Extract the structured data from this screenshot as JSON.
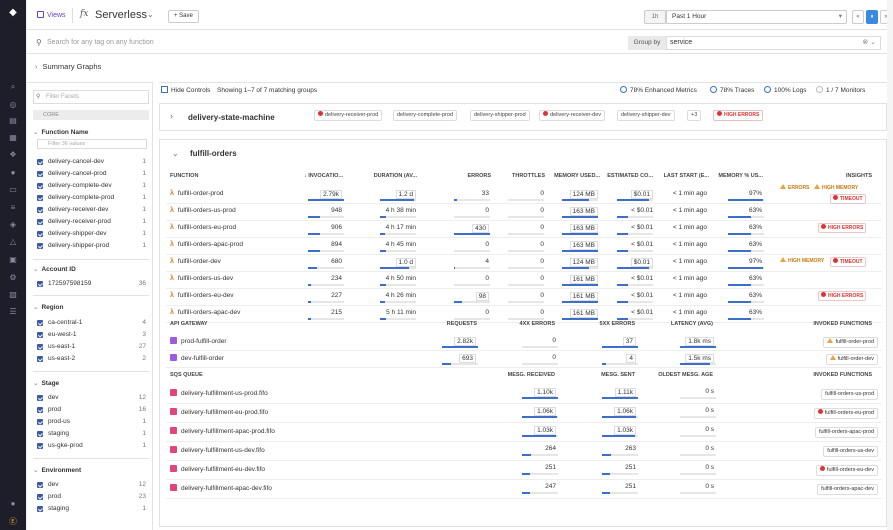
{
  "nav_icons": [
    "dog-logo-icon",
    "search-icon",
    "binoculars-icon",
    "dashboard-icon",
    "grid-icon",
    "infrastructure-icon",
    "apm-icon",
    "notebook-icon",
    "logs-icon",
    "security-icon",
    "synthetics-icon",
    "rum-icon",
    "ci-icon",
    "integrations-icon",
    "plug-icon",
    "chat-icon",
    "help-icon"
  ],
  "topbar": {
    "views_label": "Views",
    "fx": "fx",
    "title": "Serverless",
    "save_label": "+ Save",
    "time_preset": "1h",
    "time_range": "Past 1 Hour",
    "controls": [
      "«",
      "⏸",
      "»",
      "⌕"
    ]
  },
  "search": {
    "placeholder": "Search for any tag on any function",
    "group_by_label": "Group by",
    "group_by_value": "service"
  },
  "summary_graphs": "Summary Graphs",
  "sidebar": {
    "filter_placeholder": "Filter Facets",
    "core_label": "CORE",
    "function_name": {
      "title": "Function Name",
      "filter_placeholder": "Filter 36 values",
      "items": [
        {
          "name": "delivery-cancel-dev",
          "count": "1"
        },
        {
          "name": "delivery-cancel-prod",
          "count": "1"
        },
        {
          "name": "delivery-complete-dev",
          "count": "1"
        },
        {
          "name": "delivery-complete-prod",
          "count": "1"
        },
        {
          "name": "delivery-receiver-dev",
          "count": "1"
        },
        {
          "name": "delivery-receiver-prod",
          "count": "1"
        },
        {
          "name": "delivery-shipper-dev",
          "count": "1"
        },
        {
          "name": "delivery-shipper-prod",
          "count": "1"
        }
      ]
    },
    "account_id": {
      "title": "Account ID",
      "items": [
        {
          "name": "172597598159",
          "count": "36"
        }
      ]
    },
    "region": {
      "title": "Region",
      "items": [
        {
          "name": "ca-central-1",
          "count": "4"
        },
        {
          "name": "eu-west-1",
          "count": "3"
        },
        {
          "name": "us-east-1",
          "count": "27"
        },
        {
          "name": "us-east-2",
          "count": "2"
        }
      ]
    },
    "stage": {
      "title": "Stage",
      "items": [
        {
          "name": "dev",
          "count": "12"
        },
        {
          "name": "prod",
          "count": "16"
        },
        {
          "name": "prod-us",
          "count": "1"
        },
        {
          "name": "staging",
          "count": "1"
        },
        {
          "name": "us-gke-prod",
          "count": "1"
        }
      ]
    },
    "environment": {
      "title": "Environment",
      "items": [
        {
          "name": "dev",
          "count": "12"
        },
        {
          "name": "prod",
          "count": "23"
        },
        {
          "name": "staging",
          "count": "1"
        }
      ]
    }
  },
  "main": {
    "hide_controls": "Hide Controls",
    "showing": "Showing 1–7 of 7 matching groups",
    "enhanced": "78% Enhanced Metrics",
    "traces": "78% Traces",
    "logs": "100% Logs",
    "monitors": "1 / 7 Monitors",
    "dsm": {
      "name": "delivery-state-machine",
      "tags": [
        "delivery-receiver-prod",
        "delivery-complete-prod",
        "delivery-shipper-prod",
        "delivery-receiver-dev",
        "delivery-shipper-dev",
        "+3"
      ],
      "badge": "HIGH ERRORS"
    },
    "group": {
      "name": "fulfill-orders",
      "headers": {
        "function": "FUNCTION",
        "invocations": "↓ INVOCATIO...",
        "duration": "DURATION (AV...",
        "errors": "ERRORS",
        "throttles": "THROTTLES",
        "memory": "MEMORY USED...",
        "cost": "ESTIMATED CO...",
        "last_start": "LAST START (E...",
        "mem_pct": "MEMORY % US...",
        "insights": "INSIGHTS"
      },
      "functions": [
        {
          "name": "fulfill-order-prod",
          "inv": "2.79k",
          "inv_f": 1.0,
          "dur": "1.2 d",
          "dur_f": 0.95,
          "err": "33",
          "err_f": 0.08,
          "thr": "0",
          "mem": "124 MB",
          "mem_f": 0.76,
          "cost": "$0.01",
          "cost_f": 0.9,
          "last": "< 1 min ago",
          "pct": "97%",
          "pct_f": 0.97,
          "ins": [
            {
              "t": "ERRORS",
              "k": "w"
            },
            {
              "t": "HIGH MEMORY",
              "k": "w"
            },
            {
              "t": "TIMEOUT",
              "k": "e"
            }
          ]
        },
        {
          "name": "fulfill-orders-us-prod",
          "inv": "948",
          "inv_f": 0.34,
          "dur": "4 h 38 min",
          "dur_f": 0.16,
          "err": "0",
          "err_f": 0,
          "thr": "0",
          "mem": "163 MB",
          "mem_f": 1.0,
          "cost": "< $0.01",
          "cost_f": 0.3,
          "last": "< 1 min ago",
          "pct": "63%",
          "pct_f": 0.63,
          "ins": []
        },
        {
          "name": "fulfill-orders-eu-prod",
          "inv": "906",
          "inv_f": 0.32,
          "dur": "4 h 17 min",
          "dur_f": 0.15,
          "err": "430",
          "err_f": 1.0,
          "thr": "0",
          "mem": "163 MB",
          "mem_f": 1.0,
          "cost": "< $0.01",
          "cost_f": 0.3,
          "last": "< 1 min ago",
          "pct": "63%",
          "pct_f": 0.63,
          "ins": [
            {
              "t": "HIGH ERRORS",
              "k": "e"
            }
          ]
        },
        {
          "name": "fulfill-orders-apac-prod",
          "inv": "894",
          "inv_f": 0.32,
          "dur": "4 h 45 min",
          "dur_f": 0.16,
          "err": "0",
          "err_f": 0,
          "thr": "0",
          "mem": "163 MB",
          "mem_f": 1.0,
          "cost": "< $0.01",
          "cost_f": 0.3,
          "last": "< 1 min ago",
          "pct": "63%",
          "pct_f": 0.63,
          "ins": []
        },
        {
          "name": "fulfill-order-dev",
          "inv": "680",
          "inv_f": 0.24,
          "dur": "1.0 d",
          "dur_f": 0.8,
          "err": "4",
          "err_f": 0.02,
          "thr": "0",
          "mem": "124 MB",
          "mem_f": 0.76,
          "cost": "$0.01",
          "cost_f": 0.9,
          "last": "< 1 min ago",
          "pct": "97%",
          "pct_f": 0.97,
          "ins": [
            {
              "t": "HIGH MEMORY",
              "k": "w"
            },
            {
              "t": "TIMEOUT",
              "k": "e"
            }
          ]
        },
        {
          "name": "fulfill-orders-us-dev",
          "inv": "234",
          "inv_f": 0.08,
          "dur": "4 h 50 min",
          "dur_f": 0.17,
          "err": "0",
          "err_f": 0,
          "thr": "0",
          "mem": "161 MB",
          "mem_f": 0.99,
          "cost": "< $0.01",
          "cost_f": 0.3,
          "last": "< 1 min ago",
          "pct": "63%",
          "pct_f": 0.63,
          "ins": []
        },
        {
          "name": "fulfill-orders-eu-dev",
          "inv": "227",
          "inv_f": 0.08,
          "dur": "4 h 26 min",
          "dur_f": 0.15,
          "err": "98",
          "err_f": 0.23,
          "thr": "0",
          "mem": "161 MB",
          "mem_f": 0.99,
          "cost": "< $0.01",
          "cost_f": 0.3,
          "last": "< 1 min ago",
          "pct": "63%",
          "pct_f": 0.63,
          "ins": [
            {
              "t": "HIGH ERRORS",
              "k": "e"
            }
          ]
        },
        {
          "name": "fulfill-orders-apac-dev",
          "inv": "215",
          "inv_f": 0.08,
          "dur": "5 h 11 min",
          "dur_f": 0.18,
          "err": "0",
          "err_f": 0,
          "thr": "0",
          "mem": "161 MB",
          "mem_f": 0.99,
          "cost": "< $0.01",
          "cost_f": 0.3,
          "last": "< 1 min ago",
          "pct": "63%",
          "pct_f": 0.63,
          "ins": []
        }
      ],
      "api_headers": {
        "name": "API GATEWAY",
        "requests": "REQUESTS",
        "e4": "4XX ERRORS",
        "e5": "5XX ERRORS",
        "latency": "LATENCY (AVG)",
        "invoked": "INVOKED FUNCTIONS"
      },
      "apis": [
        {
          "name": "prod-fulfill-order",
          "req": "2.82k",
          "req_f": 1.0,
          "e4": "0",
          "e4_f": 0,
          "e5": "37",
          "e5_f": 1.0,
          "lat": "1.8k ms",
          "lat_f": 1.0,
          "inv": "fulfill-order-prod",
          "inv_k": "w"
        },
        {
          "name": "dev-fulfill-order",
          "req": "693",
          "req_f": 0.25,
          "e4": "0",
          "e4_f": 0,
          "e5": "4",
          "e5_f": 0.11,
          "lat": "1.5k ms",
          "lat_f": 0.83,
          "inv": "fulfill-order-dev",
          "inv_k": "w"
        }
      ],
      "sqs_headers": {
        "name": "SQS QUEUE",
        "received": "MESG. RECEIVED",
        "sent": "MESG. SENT",
        "oldest": "OLDEST MESG. AGE",
        "invoked": "INVOKED FUNCTIONS"
      },
      "queues": [
        {
          "name": "delivery-fulfillment-us-prod.fifo",
          "rec": "1.10k",
          "rec_f": 1.0,
          "sent": "1.11k",
          "sent_f": 1.0,
          "old": "0 s",
          "inv": "fulfill-orders-us-prod",
          "inv_k": ""
        },
        {
          "name": "delivery-fulfillment-eu-prod.fifo",
          "rec": "1.06k",
          "rec_f": 0.96,
          "sent": "1.06k",
          "sent_f": 0.95,
          "old": "0 s",
          "inv": "fulfill-orders-eu-prod",
          "inv_k": "e"
        },
        {
          "name": "delivery-fulfillment-apac-prod.fifo",
          "rec": "1.03k",
          "rec_f": 0.94,
          "sent": "1.03k",
          "sent_f": 0.93,
          "old": "0 s",
          "inv": "fulfill-orders-apac-prod",
          "inv_k": ""
        },
        {
          "name": "delivery-fulfillment-us-dev.fifo",
          "rec": "264",
          "rec_f": 0.24,
          "sent": "263",
          "sent_f": 0.24,
          "old": "0 s",
          "inv": "fulfill-orders-us-dev",
          "inv_k": ""
        },
        {
          "name": "delivery-fulfillment-eu-dev.fifo",
          "rec": "251",
          "rec_f": 0.23,
          "sent": "251",
          "sent_f": 0.23,
          "old": "0 s",
          "inv": "fulfill-orders-eu-dev",
          "inv_k": "e"
        },
        {
          "name": "delivery-fulfillment-apac-dev.fifo",
          "rec": "247",
          "rec_f": 0.22,
          "sent": "251",
          "sent_f": 0.23,
          "old": "0 s",
          "inv": "fulfill-orders-apac-dev",
          "inv_k": ""
        }
      ]
    }
  },
  "colors": {
    "accent": "#3b6fc9",
    "purple": "#6242c9",
    "error": "#dd3333",
    "warning": "#e8a33d",
    "lambda": "#e37b2a",
    "nav_bg": "#1e1e2b"
  }
}
